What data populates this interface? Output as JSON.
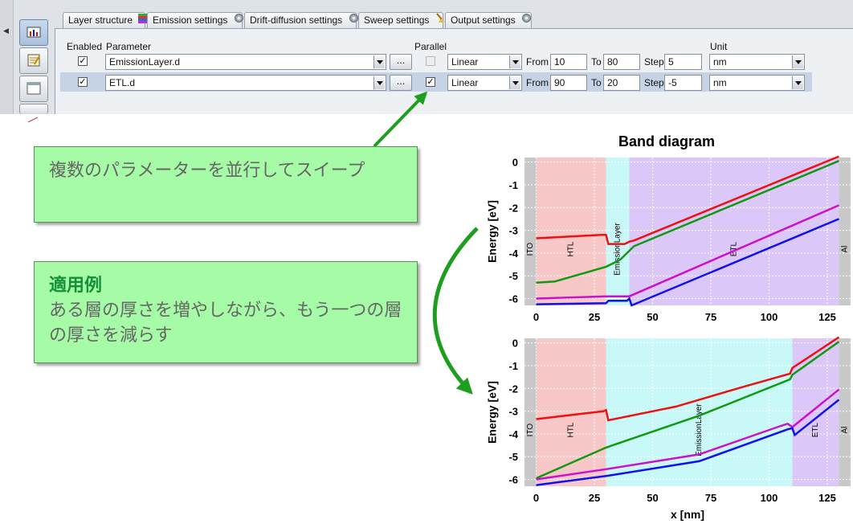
{
  "tabs": [
    {
      "label": "Layer structure",
      "icon": "layers-icon"
    },
    {
      "label": "Emission settings",
      "icon": "gear-icon"
    },
    {
      "label": "Drift-diffusion settings",
      "icon": "gear-icon"
    },
    {
      "label": "Sweep settings",
      "icon": "broom-icon",
      "active": true
    },
    {
      "label": "Output settings",
      "icon": "gear-icon"
    }
  ],
  "headers": {
    "enabled": "Enabled",
    "parameter": "Parameter",
    "parallel": "Parallel",
    "unit": "Unit"
  },
  "sweep_rows": [
    {
      "enabled": true,
      "parameter": "EmissionLayer.d",
      "browse": "...",
      "parallel": false,
      "mode": "Linear",
      "from_label": "From",
      "from": "10",
      "to_label": "To",
      "to": "80",
      "step_label": "Step",
      "step": "5",
      "unit": "nm"
    },
    {
      "enabled": true,
      "parameter": "ETL.d",
      "browse": "...",
      "parallel": true,
      "mode": "Linear",
      "from_label": "From",
      "from": "90",
      "to_label": "To",
      "to": "20",
      "step_label": "Step",
      "step": "-5",
      "unit": "nm"
    }
  ],
  "callouts": {
    "parallel": "複数のパラメーターを並行してスイープ",
    "example_title": "適用例",
    "example_body": "ある層の厚さを増やしながら、もう一つの層の厚さを減らす"
  },
  "colors": {
    "accent_green": "#1e9e1e",
    "callout_bg": "#a6fba6"
  },
  "chart_data": [
    {
      "type": "line",
      "title": "Band diagram",
      "ylabel": "Energy [eV]",
      "xlim": [
        -5,
        135
      ],
      "ylim": [
        -6.3,
        0.2
      ],
      "xticks": [
        0,
        25,
        50,
        75,
        100,
        125
      ],
      "yticks": [
        0,
        -1,
        -2,
        -3,
        -4,
        -5,
        -6
      ],
      "regions": [
        {
          "label": "ITO",
          "x": [
            -5,
            0
          ],
          "color": "#c8c8c8"
        },
        {
          "label": "HTL",
          "x": [
            0,
            30
          ],
          "color": "#f8c8c8"
        },
        {
          "label": "EmissionLayer",
          "x": [
            30,
            40
          ],
          "color": "#c8f8f8"
        },
        {
          "label": "ETL",
          "x": [
            40,
            130
          ],
          "color": "#dcc8f8"
        },
        {
          "label": "Al",
          "x": [
            130,
            135
          ],
          "color": "#c8c8c8"
        }
      ],
      "series": [
        {
          "color": "#ee1111",
          "x": [
            0,
            28,
            30,
            31,
            38,
            40,
            42,
            130
          ],
          "y": [
            -3.35,
            -3.2,
            -3.2,
            -3.6,
            -3.6,
            -3.5,
            -3.45,
            0.25
          ]
        },
        {
          "color": "#119911",
          "x": [
            0,
            8,
            30,
            36,
            39,
            42,
            130
          ],
          "y": [
            -5.3,
            -5.25,
            -4.6,
            -4.3,
            -4.0,
            -3.7,
            0.05
          ]
        },
        {
          "color": "#cc11cc",
          "x": [
            0,
            30,
            40,
            130
          ],
          "y": [
            -6.0,
            -5.9,
            -5.9,
            -1.9
          ]
        },
        {
          "color": "#1111ee",
          "x": [
            0,
            30,
            31,
            39,
            40,
            41,
            130
          ],
          "y": [
            -6.25,
            -6.2,
            -6.1,
            -6.1,
            -6.0,
            -6.3,
            -2.5
          ]
        }
      ]
    },
    {
      "type": "line",
      "title": "",
      "xlabel": "x [nm]",
      "ylabel": "Energy [eV]",
      "xlim": [
        -5,
        135
      ],
      "ylim": [
        -6.3,
        0.2
      ],
      "xticks": [
        0,
        25,
        50,
        75,
        100,
        125
      ],
      "yticks": [
        0,
        -1,
        -2,
        -3,
        -4,
        -5,
        -6
      ],
      "regions": [
        {
          "label": "ITO",
          "x": [
            -5,
            0
          ],
          "color": "#c8c8c8"
        },
        {
          "label": "HTL",
          "x": [
            0,
            30
          ],
          "color": "#f8c8c8"
        },
        {
          "label": "EmissionLayer",
          "x": [
            30,
            110
          ],
          "color": "#c8f8f8"
        },
        {
          "label": "ETL",
          "x": [
            110,
            130
          ],
          "color": "#dcc8f8"
        },
        {
          "label": "Al",
          "x": [
            130,
            135
          ],
          "color": "#c8c8c8"
        }
      ],
      "series": [
        {
          "color": "#ee1111",
          "x": [
            0,
            29,
            30,
            31,
            60,
            90,
            109,
            110,
            130
          ],
          "y": [
            -3.35,
            -3.0,
            -2.95,
            -3.4,
            -2.8,
            -1.9,
            -1.35,
            -1.1,
            0.25
          ]
        },
        {
          "color": "#119911",
          "x": [
            0,
            30,
            70,
            109,
            110,
            130
          ],
          "y": [
            -5.95,
            -4.6,
            -3.2,
            -1.6,
            -1.4,
            0.05
          ]
        },
        {
          "color": "#cc11cc",
          "x": [
            0,
            30,
            70,
            105,
            108,
            110,
            130
          ],
          "y": [
            -6.0,
            -5.55,
            -4.9,
            -3.65,
            -3.55,
            -3.7,
            -2.05
          ]
        },
        {
          "color": "#1111ee",
          "x": [
            0,
            30,
            70,
            108,
            110,
            111,
            130
          ],
          "y": [
            -6.25,
            -5.85,
            -5.2,
            -3.8,
            -3.75,
            -4.05,
            -2.5
          ]
        }
      ]
    }
  ]
}
